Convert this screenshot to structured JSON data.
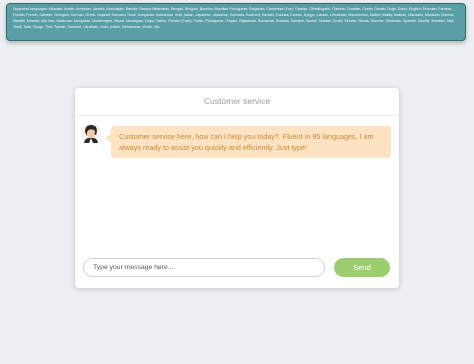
{
  "banner": {
    "text": "Supported languages: Albanian, Arabic, Armenian, Awadhi, Azerbaijani, Bashkir, Basque,Belarusian, Bengali, Bhojpuri, Bosnian, Brazilian Portuguese, Bulgarian, Cantonese (Yue), Catalan, Chhattisgarhi, Chinese, Croatian, Czech, Danish, Dogri, Dutch, English, Estonian, Faroese, Finnish, French, Galician, Georgian, German, Greek, Gujarati, Haryanvi, Hindi, Hungarian, Indonesian, Irish, Italian, Japanese, Javanese, Kannada, Kashmiri, Kazakh, Konkani, Korean, Kyrgyz, Latvian, Lithuanian, Macedonian, Maithili, Malay, Maltese, Mandarin, Mandarin Chinese, Marathi, Marwari, Min Nan, Moldovan, Mongolian, Montenegrin, Nepali, Norwegian, Oriya, Pashto, Persian (Farsi), Polish, Portuguese, Punjabi, Rajasthani, Romanian, Russian, Sanskrit, Santali, Serbian, Sindhi, Sinhala, Slovak, Slovene, Slovenian, Spanish, Swahili, Swedish, Tajik, Tamil, Tatar, Telugu, Thai, Turkish, Turkmen, Ukrainian, Urdu, Uzbek, Vietnamese, Welsh, Wu"
  },
  "chat": {
    "title": "Customer service",
    "welcome_message": "Customer service here, how can I help you today?. Fluent in 95 languages, I am always ready to assist you quickly and efficiently. Just type!",
    "input_placeholder": "Type your message here...",
    "input_value": "",
    "send_label": "Send"
  },
  "colors": {
    "banner_bg": "#5a9ea6",
    "bubble_bg": "#fde3c2",
    "bubble_text": "#c8893a",
    "send_button": "#9ccd6e"
  },
  "icons": {
    "agent_avatar": "agent-avatar-icon"
  }
}
